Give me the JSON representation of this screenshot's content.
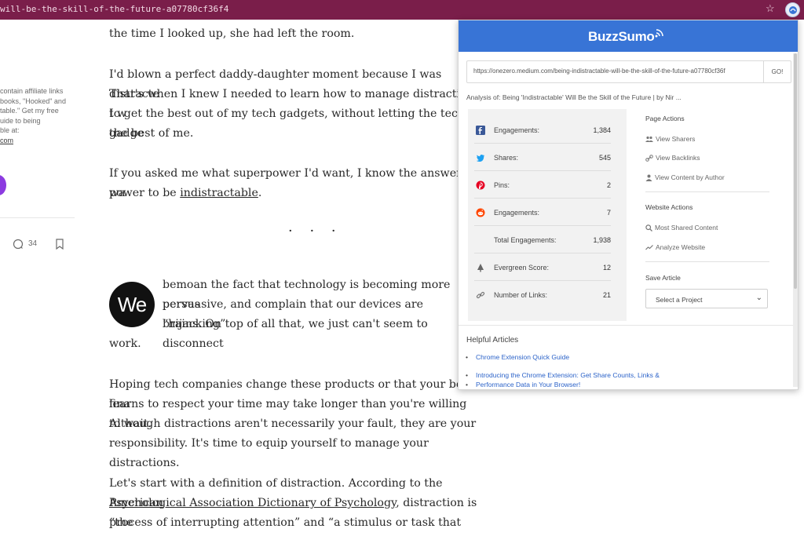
{
  "browser": {
    "url_fragment": "will-be-the-skill-of-the-future-a07780cf36f4"
  },
  "sidebar": {
    "lines": [
      "contain affiliate links",
      "books, \"Hooked\" and",
      "table.\" Get my free",
      "uide to being",
      "ble at:"
    ],
    "link": "com",
    "comment_count": "34"
  },
  "article": {
    "p1": "the time I looked up, she had left the room.",
    "p2_l1": "I'd blown a perfect daddy-daughter moment because I was distracte",
    "p2_l2": "That's when I knew I needed to learn how to manage distraction. I w",
    "p2_l3": "to get the best out of my tech gadgets, without letting the tech gadge",
    "p2_l4": "the best of me.",
    "p3_l1": "If you asked me what superpower I'd want, I know the answer: I wa",
    "p3_l2_pre": "power to be ",
    "p3_l2_link": "indistractable",
    "p3_l2_post": ".",
    "separator": "· · ·",
    "badge": "We",
    "p4_l1": "bemoan the fact that technology is becoming more pervas",
    "p4_l2": "persuasive, and complain that our devices are “hijacking”",
    "p4_l3": "brains. On top of all that, we just can't seem to disconnect",
    "p4_l4": "work.",
    "p5_l1": "Hoping tech companies change these products or that your boss fina",
    "p5_l2": "learns to respect your time may take longer than you're willing to wait.",
    "p5_l3": "Although distractions aren't necessarily your fault, they are your",
    "p5_l4": "responsibility. It's time to equip yourself to manage your distractions.",
    "p6_l1_pre": "Let's start with a definition of distraction. According to the ",
    "p6_l1_link": "American",
    "p6_l2_link": "Psychological Association Dictionary of Psychology",
    "p6_l2_post": ", distraction is “the",
    "p6_l3": "process of interrupting attention” and “a stimulus or task that draws"
  },
  "buzzsumo": {
    "logo": "BuzzSumo",
    "url_value": "https://onezero.medium.com/being-indistractable-will-be-the-skill-of-the-future-a07780cf36f",
    "go_label": "GO!",
    "analysis": "Analysis of: Being 'Indistractable' Will Be the Skill of the Future | by Nir ...",
    "stats": [
      {
        "icon": "facebook-icon",
        "label": "Engagements:",
        "value": "1,384"
      },
      {
        "icon": "twitter-icon",
        "label": "Shares:",
        "value": "545"
      },
      {
        "icon": "pinterest-icon",
        "label": "Pins:",
        "value": "2"
      },
      {
        "icon": "reddit-icon",
        "label": "Engagements:",
        "value": "7"
      },
      {
        "icon": "",
        "label": "Total Engagements:",
        "value": "1,938"
      },
      {
        "icon": "evergreen-icon",
        "label": "Evergreen Score:",
        "value": "12"
      },
      {
        "icon": "link-icon",
        "label": "Number of Links:",
        "value": "21"
      }
    ],
    "page_actions_title": "Page Actions",
    "page_actions": [
      "View Sharers",
      "View Backlinks",
      "View Content by Author"
    ],
    "website_actions_title": "Website Actions",
    "website_actions": [
      "Most Shared Content",
      "Analyze Website"
    ],
    "save_article_title": "Save Article",
    "select_value": "Select a Project",
    "helpful_title": "Helpful Articles",
    "helpful": [
      "Chrome Extension Quick Guide",
      "Introducing the Chrome Extension: Get Share Counts, Links &",
      "Performance Data in Your Browser!"
    ]
  },
  "colors": {
    "topbar": "#7a1e4a",
    "buzzsumo_blue": "#3874d6",
    "facebook": "#3b5998",
    "twitter": "#1da1f2",
    "pinterest": "#e60023",
    "reddit": "#ff4500"
  }
}
